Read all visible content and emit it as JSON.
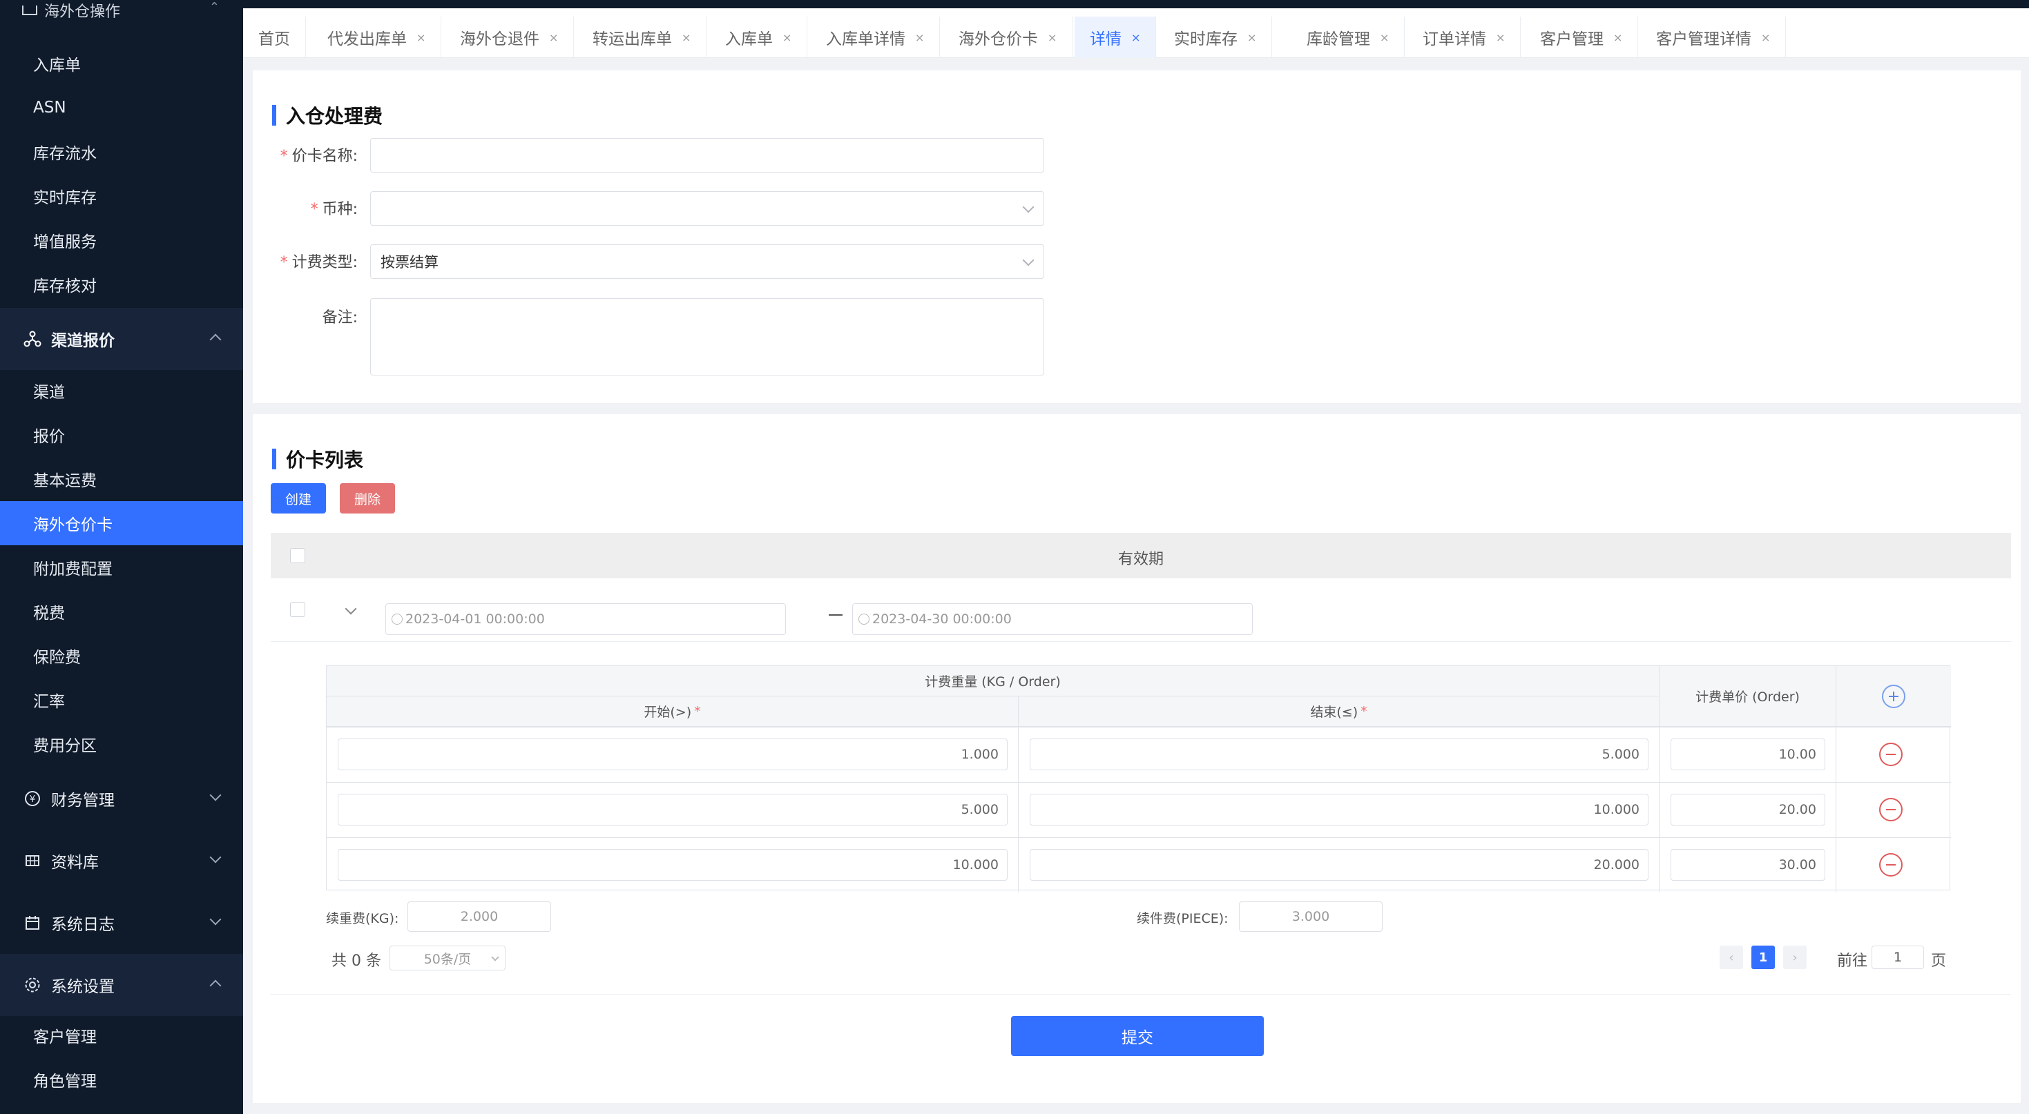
{
  "sidebar": {
    "top_group": "海外仓操作",
    "items_a": [
      "入库单",
      "ASN",
      "库存流水",
      "实时库存",
      "增值服务",
      "库存核对"
    ],
    "group_channel": "渠道报价",
    "items_b": [
      "渠道",
      "报价",
      "基本运费",
      "海外仓价卡",
      "附加费配置",
      "税费",
      "保险费",
      "汇率",
      "费用分区"
    ],
    "group_finance": "财务管理",
    "group_materials": "资料库",
    "group_logs": "系统日志",
    "group_settings": "系统设置",
    "items_c": [
      "客户管理",
      "角色管理"
    ],
    "active_item": "海外仓价卡",
    "accent": "#3370ff"
  },
  "tabs": [
    {
      "label": "首页",
      "closable": false
    },
    {
      "label": "代发出库单",
      "closable": true
    },
    {
      "label": "海外仓退件",
      "closable": true
    },
    {
      "label": "转运出库单",
      "closable": true
    },
    {
      "label": "入库单",
      "closable": true
    },
    {
      "label": "入库单详情",
      "closable": true
    },
    {
      "label": "海外仓价卡",
      "closable": true
    },
    {
      "label": "详情",
      "closable": true,
      "active": true
    },
    {
      "label": "实时库存",
      "closable": true
    },
    {
      "label": "库龄管理",
      "closable": true
    },
    {
      "label": "订单详情",
      "closable": true
    },
    {
      "label": "客户管理",
      "closable": true
    },
    {
      "label": "客户管理详情",
      "closable": true
    }
  ],
  "close_glyph": "×",
  "form": {
    "title": "入仓处理费",
    "name_label": "价卡名称:",
    "name_value": "",
    "currency_label": "币种:",
    "currency_value": "",
    "billing_label": "计费类型:",
    "billing_value": "按票结算",
    "remark_label": "备注:",
    "remark_value": "",
    "required_mark": "*"
  },
  "list": {
    "title": "价卡列表",
    "create_label": "创建",
    "delete_label": "删除",
    "validity_header": "有效期",
    "date_start": "2023-04-01 00:00:00",
    "date_end": "2023-04-30 00:00:00",
    "inner": {
      "weight_header": "计费重量 (KG / Order)",
      "start_header": "开始(>)",
      "end_header": "结束(≤)",
      "unit_price_header": "计费单价 (Order)",
      "rows": [
        {
          "start": "1.000",
          "end": "5.000",
          "price": "10.00"
        },
        {
          "start": "5.000",
          "end": "10.000",
          "price": "20.00"
        },
        {
          "start": "10.000",
          "end": "20.000",
          "price": "30.00"
        }
      ]
    },
    "extra_weight_label": "续重费(KG):",
    "extra_weight_value": "2.000",
    "extra_piece_label": "续件费(PIECE):",
    "extra_piece_value": "3.000",
    "total_text": "共 0 条",
    "page_size": "50条/页",
    "prev": "‹",
    "current_page": "1",
    "next": "›",
    "goto_label": "前往",
    "goto_value": "1",
    "page_unit": "页",
    "submit_label": "提交"
  }
}
